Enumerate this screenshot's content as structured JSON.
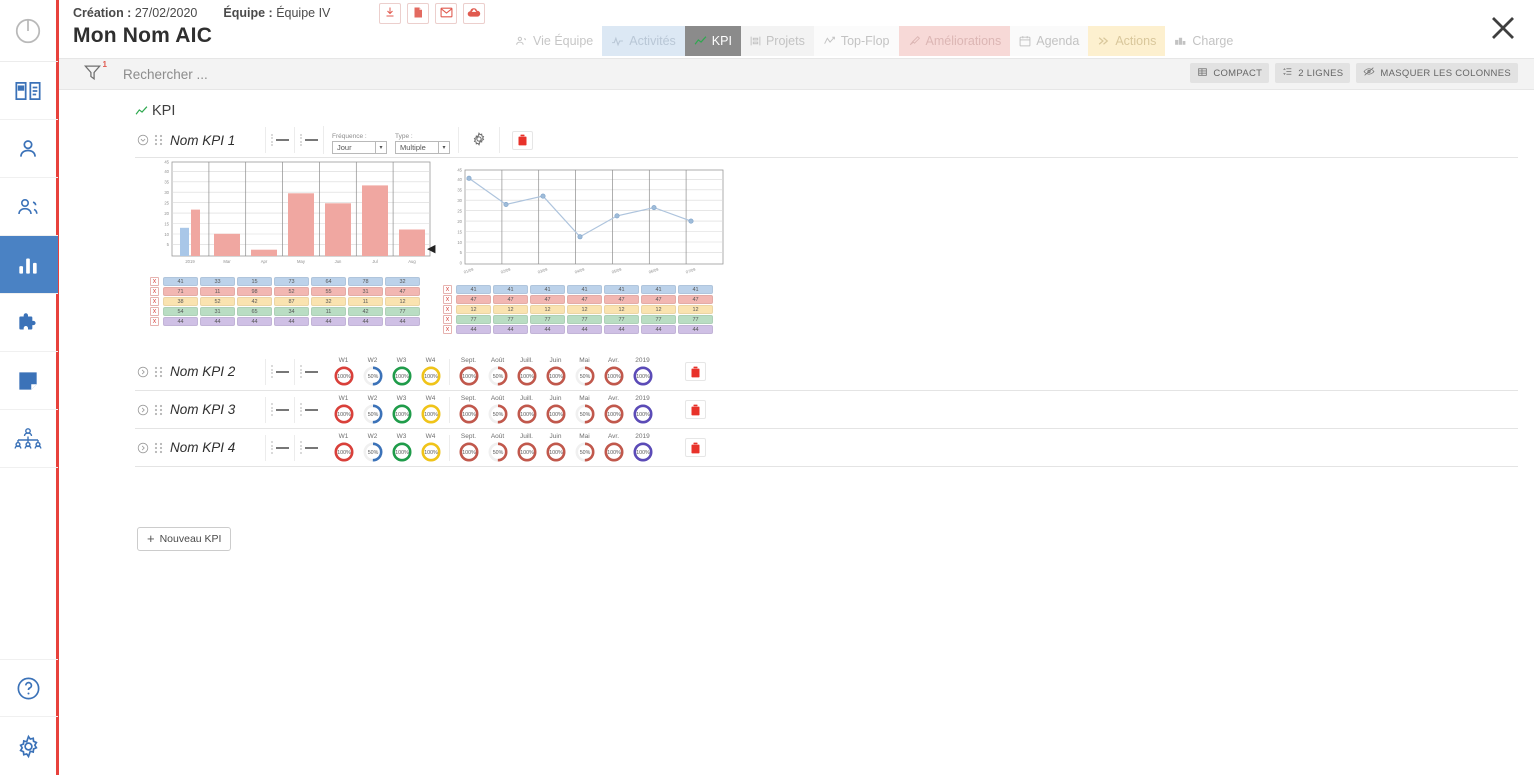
{
  "sidebar": {
    "items": [
      {
        "name": "power-icon",
        "label": "Power"
      },
      {
        "name": "media-book-icon",
        "label": "Documentation"
      },
      {
        "name": "user-icon",
        "label": "Utilisateur"
      },
      {
        "name": "team-icon",
        "label": "Équipe"
      },
      {
        "name": "bar-chart-icon",
        "label": "Indicateurs",
        "active": true
      },
      {
        "name": "puzzle-icon",
        "label": "Modules"
      },
      {
        "name": "note-icon",
        "label": "Notes"
      },
      {
        "name": "org-chart-icon",
        "label": "Organisation"
      }
    ],
    "bottom": [
      {
        "name": "help-icon",
        "label": "Aide"
      },
      {
        "name": "settings-gear-icon",
        "label": "Paramètres"
      }
    ]
  },
  "header": {
    "creation_label": "Création :",
    "creation_value": "27/02/2020",
    "team_label": "Équipe :",
    "team_value": "Équipe IV",
    "title": "Mon Nom AIC",
    "actions": [
      {
        "name": "download-icon",
        "label": "Télécharger"
      },
      {
        "name": "pdf-icon",
        "label": "Export PDF"
      },
      {
        "name": "mail-icon",
        "label": "Envoyer par mail"
      },
      {
        "name": "cloud-upload-icon",
        "label": "Envoyer vers le cloud"
      }
    ],
    "close_label": "Fermer"
  },
  "tabs": [
    {
      "label": "Vie Équipe",
      "icon": "people-icon",
      "cls": "t-vie",
      "active": false
    },
    {
      "label": "Activités",
      "icon": "activity-icon",
      "cls": "t-act",
      "active": false
    },
    {
      "label": "KPI",
      "icon": "trend-icon",
      "cls": "t-kpi",
      "active": true
    },
    {
      "label": "Projets",
      "icon": "project-icon",
      "cls": "t-proj",
      "active": false
    },
    {
      "label": "Top-Flop",
      "icon": "updown-icon",
      "cls": "t-top",
      "active": false
    },
    {
      "label": "Améliorations",
      "icon": "brush-icon",
      "cls": "t-amel",
      "active": false
    },
    {
      "label": "Agenda",
      "icon": "calendar-icon",
      "cls": "t-agenda",
      "active": false
    },
    {
      "label": "Actions",
      "icon": "chevrons-icon",
      "cls": "t-actions",
      "active": false
    },
    {
      "label": "Charge",
      "icon": "load-icon",
      "cls": "t-charge",
      "active": false
    }
  ],
  "toolbar": {
    "filter_badge": "1",
    "search_placeholder": "Rechercher ...",
    "search_value": "",
    "buttons": [
      {
        "label": "COMPACT",
        "icon": "compact-table-icon"
      },
      {
        "label": "2 LIGNES",
        "icon": "line-height-icon"
      },
      {
        "label": "MASQUER LES COLONNES",
        "icon": "eye-off-icon"
      }
    ]
  },
  "section": {
    "title": "KPI",
    "icon": "trend-icon"
  },
  "kpi1": {
    "name": "Nom KPI 1",
    "frequence_label": "Fréquence :",
    "frequence_value": "Jour",
    "type_label": "Type :",
    "type_value": "Multiple",
    "settings_label": "Paramètres",
    "delete_label": "Supprimer"
  },
  "chart_data": [
    {
      "type": "bar",
      "title": "",
      "categories": [
        "2019",
        "Mar",
        "Apr",
        "May",
        "Jun",
        "Jul",
        "Aug"
      ],
      "series": [
        {
          "name": "Série bleue",
          "color": "#a9c7e8",
          "values": [
            13.5,
            null,
            null,
            null,
            null,
            null,
            null
          ]
        },
        {
          "name": "Série rouge",
          "color": "#f0a7a1",
          "values": [
            22.2,
            10.6,
            3.0,
            30.0,
            25.4,
            33.8,
            12.7
          ]
        }
      ],
      "xlabel": "",
      "ylabel": "",
      "ylim": [
        0,
        45
      ],
      "yticks": [
        5,
        10,
        15,
        20,
        25,
        30,
        35,
        40,
        45
      ],
      "grid": true,
      "legend": "none"
    },
    {
      "type": "line",
      "title": "",
      "x": [
        "01/09",
        "02/09",
        "03/09",
        "04/09",
        "05/09",
        "06/09",
        "07/09"
      ],
      "series": [
        {
          "name": "Série",
          "color": "#9fbcd9",
          "values": [
            41,
            28.5,
            32.5,
            13,
            23,
            27,
            20.5
          ]
        }
      ],
      "xlabel": "",
      "ylabel": "",
      "ylim": [
        0,
        45
      ],
      "yticks": [
        0,
        5,
        10,
        15,
        20,
        25,
        30,
        35,
        40,
        45
      ],
      "grid": true,
      "legend": "none"
    }
  ],
  "table_left": {
    "remove_label": "x",
    "rows": [
      {
        "color": "#bcd2ea",
        "values": [
          "41",
          "33",
          "15",
          "73",
          "64",
          "78",
          "32"
        ]
      },
      {
        "color": "#f2b7b2",
        "values": [
          "71",
          "11",
          "98",
          "52",
          "55",
          "31",
          "47"
        ]
      },
      {
        "color": "#fae3b0",
        "values": [
          "38",
          "52",
          "42",
          "87",
          "32",
          "11",
          "12"
        ]
      },
      {
        "color": "#b9ddc3",
        "values": [
          "54",
          "31",
          "65",
          "34",
          "11",
          "42",
          "77"
        ]
      },
      {
        "color": "#cfc0e5",
        "values": [
          "44",
          "44",
          "44",
          "44",
          "44",
          "44",
          "44"
        ]
      }
    ]
  },
  "table_right": {
    "remove_label": "x",
    "rows": [
      {
        "color": "#bcd2ea",
        "values": [
          "41",
          "41",
          "41",
          "41",
          "41",
          "41",
          "41"
        ]
      },
      {
        "color": "#f2b7b2",
        "values": [
          "47",
          "47",
          "47",
          "47",
          "47",
          "47",
          "47"
        ]
      },
      {
        "color": "#fae3b0",
        "values": [
          "12",
          "12",
          "12",
          "12",
          "12",
          "12",
          "12"
        ]
      },
      {
        "color": "#b9ddc3",
        "values": [
          "77",
          "77",
          "77",
          "77",
          "77",
          "77",
          "77"
        ]
      },
      {
        "color": "#cfc0e5",
        "values": [
          "44",
          "44",
          "44",
          "44",
          "44",
          "44",
          "44"
        ]
      }
    ]
  },
  "gauge_weeks": [
    {
      "label": "W1",
      "value": "100%",
      "pct": 100,
      "color": "#d9403a"
    },
    {
      "label": "W2",
      "value": "50%",
      "pct": 50,
      "color": "#3b72b8"
    },
    {
      "label": "W3",
      "value": "100%",
      "pct": 100,
      "color": "#1f9c4a"
    },
    {
      "label": "W4",
      "value": "100%",
      "pct": 100,
      "color": "#f0c419"
    }
  ],
  "gauge_months": [
    {
      "label": "Sept.",
      "value": "100%",
      "pct": 100,
      "color": "#c1584c"
    },
    {
      "label": "Août",
      "value": "50%",
      "pct": 50,
      "color": "#c1584c"
    },
    {
      "label": "Juill.",
      "value": "100%",
      "pct": 100,
      "color": "#c1584c"
    },
    {
      "label": "Juin",
      "value": "100%",
      "pct": 100,
      "color": "#c1584c"
    },
    {
      "label": "Mai",
      "value": "50%",
      "pct": 50,
      "color": "#c1584c"
    },
    {
      "label": "Avr.",
      "value": "100%",
      "pct": 100,
      "color": "#c1584c"
    },
    {
      "label": "2019",
      "value": "100%",
      "pct": 100,
      "color": "#5b4bb7"
    }
  ],
  "kpi_rows": [
    {
      "name": "Nom KPI 2"
    },
    {
      "name": "Nom KPI 3"
    },
    {
      "name": "Nom KPI 4"
    }
  ],
  "footer": {
    "new_kpi_label": "Nouveau KPI"
  },
  "colors": {
    "accent_red": "#e8413c",
    "sidebar_active": "#4a82c4",
    "tab_active_bg": "#8b8b8b",
    "green": "#2ea84f"
  }
}
